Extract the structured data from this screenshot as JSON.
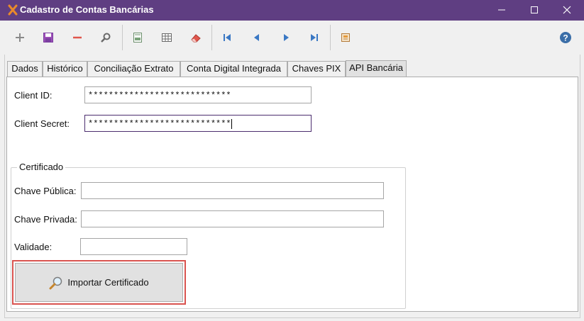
{
  "window": {
    "title": "Cadastro de Contas Bancárias",
    "icon": "app-logo-icon",
    "controls": [
      "minimize-icon",
      "maximize-icon",
      "close-icon"
    ]
  },
  "toolbar": {
    "buttons": [
      "add-icon",
      "save-icon",
      "delete-icon",
      "search-icon",
      "report-icon",
      "grid-icon",
      "eraser-icon",
      "first-record-icon",
      "previous-record-icon",
      "next-record-icon",
      "last-record-icon",
      "export-icon",
      "help-icon"
    ]
  },
  "tabs": [
    {
      "label": "Dados"
    },
    {
      "label": "Histórico"
    },
    {
      "label": "Conciliação Extrato"
    },
    {
      "label": "Conta Digital Integrada"
    },
    {
      "label": "Chaves PIX"
    },
    {
      "label": "API Bancária"
    }
  ],
  "active_tab": "API Bancária",
  "api": {
    "client_id_label": "Client ID:",
    "client_id_value": "****************************",
    "client_secret_label": "Client Secret:",
    "client_secret_value": "****************************"
  },
  "certificado": {
    "group_title": "Certificado",
    "public_key_label": "Chave Pública:",
    "public_key_value": "",
    "private_key_label": "Chave Privada:",
    "private_key_value": "",
    "validity_label": "Validade:",
    "validity_value": "",
    "import_button_label": "Importar Certificado"
  },
  "colors": {
    "titlebar": "#5f3e82",
    "accent": "#7b3fa0",
    "highlight_outline": "#d9534f",
    "help": "#3b6ea8"
  }
}
